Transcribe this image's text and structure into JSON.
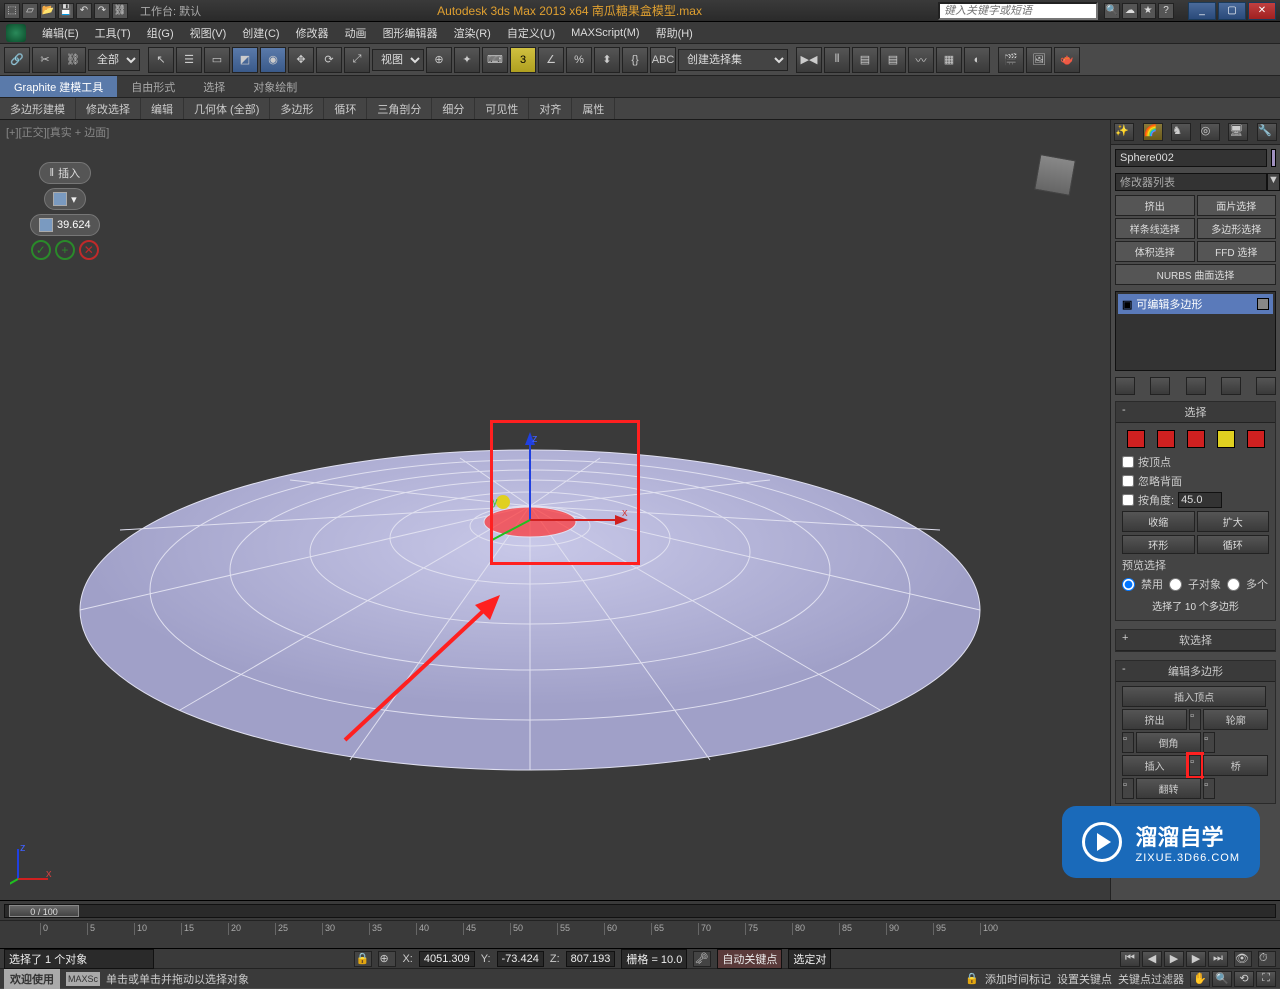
{
  "titlebar": {
    "workspace_label": "工作台: 默认",
    "app_title": "Autodesk 3ds Max  2013 x64   南瓜糖果盒模型.max",
    "search_placeholder": "键入关键字或短语"
  },
  "menubar": {
    "items": [
      "编辑(E)",
      "工具(T)",
      "组(G)",
      "视图(V)",
      "创建(C)",
      "修改器",
      "动画",
      "图形编辑器",
      "渲染(R)",
      "自定义(U)",
      "MAXScript(M)",
      "帮助(H)"
    ]
  },
  "toolbar": {
    "filter": "全部",
    "view_select": "视图",
    "selection_set": "创建选择集"
  },
  "ribbon": {
    "tabs": [
      "Graphite 建模工具",
      "自由形式",
      "选择",
      "对象绘制"
    ],
    "sub": [
      "多边形建模",
      "修改选择",
      "编辑",
      "几何体 (全部)",
      "多边形",
      "循环",
      "三角剖分",
      "细分",
      "可见性",
      "对齐",
      "属性"
    ]
  },
  "viewport": {
    "label": "[+][正交][真实 + 边面]"
  },
  "caddy": {
    "title": "插入",
    "value": "39.624"
  },
  "cmd_panel": {
    "object_name": "Sphere002",
    "modifier_list": "修改器列表",
    "mod_buttons": [
      "挤出",
      "面片选择",
      "样条线选择",
      "多边形选择",
      "体积选择",
      "FFD 选择"
    ],
    "nurbs_row": "NURBS 曲面选择",
    "stack_item": "可编辑多边形",
    "rollouts": {
      "selection": {
        "title": "选择",
        "by_vertex": "按顶点",
        "ignore_back": "忽略背面",
        "by_angle": "按角度:",
        "angle_val": "45.0",
        "shrink": "收缩",
        "grow": "扩大",
        "ring": "环形",
        "loop": "循环",
        "preview": "预览选择",
        "r_off": "禁用",
        "r_sub": "子对象",
        "r_multi": "多个",
        "count": "选择了 10 个多边形"
      },
      "soft": {
        "title": "软选择"
      },
      "edit_poly": {
        "title": "编辑多边形",
        "insert_vert": "插入顶点",
        "extrude": "挤出",
        "outline": "轮廓",
        "bevel": "倒角",
        "inset": "插入",
        "bridge": "桥",
        "flip": "翻转"
      }
    }
  },
  "time": {
    "slider": "0 / 100",
    "ticks": [
      0,
      5,
      10,
      15,
      20,
      25,
      30,
      35,
      40,
      45,
      50,
      55,
      60,
      65,
      70,
      75,
      80,
      85,
      90,
      95,
      100
    ]
  },
  "status": {
    "selected": "选择了 1 个对象",
    "x": "4051.309",
    "y": "-73.424",
    "z": "807.193",
    "grid": "栅格 = 10.0",
    "autokey": "自动关键点",
    "selset": "选定对",
    "hint": "单击或单击并拖动以选择对象",
    "addtag": "添加时间标记",
    "setkey": "设置关键点",
    "keyfilter": "关键点过滤器",
    "welcome": "欢迎使用",
    "maxsc": "MAXSc"
  },
  "watermark": {
    "big": "溜溜自学",
    "small": "ZIXUE.3D66.COM"
  }
}
